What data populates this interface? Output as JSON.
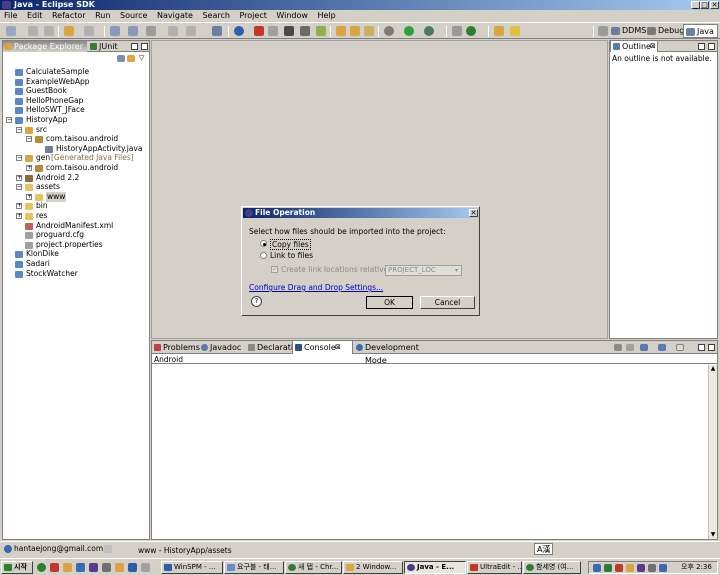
{
  "window": {
    "title": "Java - Eclipse SDK",
    "controls": [
      "_",
      "□",
      "✕"
    ]
  },
  "menu": [
    "File",
    "Edit",
    "Refactor",
    "Run",
    "Source",
    "Navigate",
    "Search",
    "Project",
    "Window",
    "Help"
  ],
  "perspectives": [
    {
      "label": "DDMS",
      "icon": "ddms-icon"
    },
    {
      "label": "Debug",
      "icon": "debug-icon"
    },
    {
      "label": "Java",
      "icon": "java-icon",
      "active": true
    }
  ],
  "left_panel": {
    "tabs": [
      "Package Explorer",
      "JUnit"
    ],
    "tree": [
      {
        "label": "CalculateSample",
        "level": 0,
        "icon": "project"
      },
      {
        "label": "ExampleWebApp",
        "level": 0,
        "icon": "project"
      },
      {
        "label": "GuestBook",
        "level": 0,
        "icon": "project"
      },
      {
        "label": "HelloPhoneGap",
        "level": 0,
        "icon": "project"
      },
      {
        "label": "HelloSWT_JFace",
        "level": 0,
        "icon": "project"
      },
      {
        "label": "HistoryApp",
        "level": 0,
        "icon": "project",
        "expanded": true
      },
      {
        "label": "src",
        "level": 1,
        "icon": "srcfolder",
        "expanded": true
      },
      {
        "label": "com.taisou.android",
        "level": 2,
        "icon": "package",
        "expanded": true
      },
      {
        "label": "HistoryAppActivity.java",
        "level": 3,
        "icon": "javafile"
      },
      {
        "label": "gen",
        "suffix": "[Generated Java Files]",
        "level": 1,
        "icon": "srcfolder",
        "expanded": true
      },
      {
        "label": "com.taisou.android",
        "level": 2,
        "icon": "package"
      },
      {
        "label": "Android 2.2",
        "level": 1,
        "icon": "library"
      },
      {
        "label": "assets",
        "level": 1,
        "icon": "folder",
        "expanded": true
      },
      {
        "label": "www",
        "level": 2,
        "icon": "folder",
        "selected": true
      },
      {
        "label": "bin",
        "level": 1,
        "icon": "folder"
      },
      {
        "label": "res",
        "level": 1,
        "icon": "folder"
      },
      {
        "label": "AndroidManifest.xml",
        "level": 1,
        "icon": "xmlfile"
      },
      {
        "label": "proguard.cfg",
        "level": 1,
        "icon": "file"
      },
      {
        "label": "project.properties",
        "level": 1,
        "icon": "file"
      },
      {
        "label": "KlonDike",
        "level": 0,
        "icon": "project"
      },
      {
        "label": "Sadari",
        "level": 0,
        "icon": "project"
      },
      {
        "label": "StockWatcher",
        "level": 0,
        "icon": "project"
      }
    ]
  },
  "outline": {
    "tab": "Outline",
    "message": "An outline is not available."
  },
  "bottom_panel": {
    "tabs": [
      "Problems",
      "Javadoc",
      "Declaration",
      "Console",
      "Development Mode"
    ],
    "active_tab": "Console",
    "console_name": "Android"
  },
  "dialog": {
    "title": "File Operation",
    "prompt": "Select how files should be imported into the project:",
    "option_copy": "Copy files",
    "option_link": "Link to files",
    "checkbox_label": "Create link locations relative to:",
    "combo_value": "PROJECT_LOC",
    "link": "Configure Drag and Drop Settings...",
    "ok": "OK",
    "cancel": "Cancel",
    "help": "?"
  },
  "status": {
    "account": "hantaejong@gmail.com",
    "path": "www - HistoryApp/assets",
    "ime": "A漢"
  },
  "taskbar": {
    "start": "시작",
    "tasks": [
      "WinSPM - ...",
      "요구블 - 태...",
      "새 탭 - Chr...",
      "2 Window...",
      "Java - E...",
      "UltraEdit - ...",
      "함세영 (여..."
    ],
    "active_task": "Java - E...",
    "clock": "오후 2:36"
  }
}
